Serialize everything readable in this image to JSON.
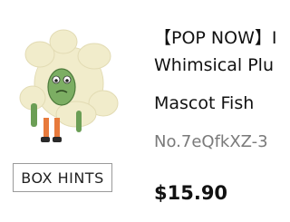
{
  "product": {
    "title_line1": "【POP NOW】",
    "title_line1_tail": "I",
    "title_line2": "Whimsical Plu",
    "title_line3": "Mascot Fish",
    "serial": "No.7eQfkXZ-3",
    "price": "$15.90",
    "image_icon": "mascot-fish-figure"
  },
  "actions": {
    "box_hints_label": "BOX HINTS"
  },
  "colors": {
    "price": "#111111",
    "serial": "#7a7a7a",
    "button_border": "#9a9a9a"
  }
}
